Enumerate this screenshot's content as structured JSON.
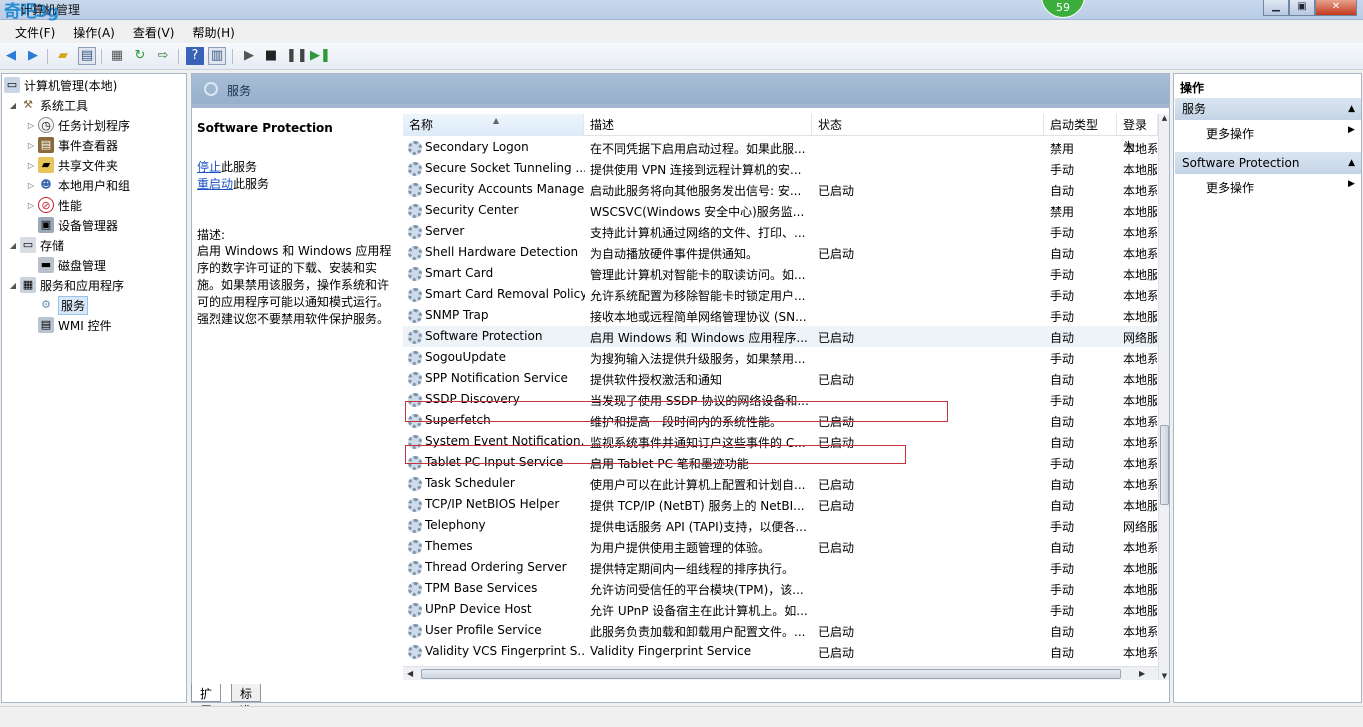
{
  "window": {
    "title": "计算机管理",
    "badge": "59",
    "logo_a": "奇吧",
    "logo_b": "3g"
  },
  "menu": [
    "文件(F)",
    "操作(A)",
    "查看(V)",
    "帮助(H)"
  ],
  "tree": [
    {
      "label": "计算机管理(本地)",
      "expander": "",
      "level": 0
    },
    {
      "label": "系统工具",
      "expander": "◢",
      "level": 1
    },
    {
      "label": "任务计划程序",
      "expander": "▷",
      "level": 2
    },
    {
      "label": "事件查看器",
      "expander": "▷",
      "level": 2
    },
    {
      "label": "共享文件夹",
      "expander": "▷",
      "level": 2
    },
    {
      "label": "本地用户和组",
      "expander": "▷",
      "level": 2
    },
    {
      "label": "性能",
      "expander": "▷",
      "level": 2
    },
    {
      "label": "设备管理器",
      "expander": "",
      "level": 2
    },
    {
      "label": "存储",
      "expander": "◢",
      "level": 1
    },
    {
      "label": "磁盘管理",
      "expander": "",
      "level": 2
    },
    {
      "label": "服务和应用程序",
      "expander": "◢",
      "level": 1
    },
    {
      "label": "服务",
      "expander": "",
      "level": 2
    },
    {
      "label": "WMI 控件",
      "expander": "",
      "level": 2
    }
  ],
  "center": {
    "header": "服务",
    "selected_service": "Software Protection",
    "stop_link": "停止",
    "stop_rest": "此服务",
    "restart_link": "重启动",
    "restart_rest": "此服务",
    "desc_label": "描述:",
    "desc_body": "启用 Windows 和 Windows 应用程序的数字许可证的下载、安装和实施。如果禁用该服务，操作系统和许可的应用程序可能以通知模式运行。强烈建议您不要禁用软件保护服务。"
  },
  "columns": [
    "名称",
    "描述",
    "状态",
    "启动类型",
    "登录为"
  ],
  "services": [
    {
      "name": "Secondary Logon",
      "desc": "在不同凭据下启用启动过程。如果此服...",
      "status": "",
      "startup": "禁用",
      "logon": "本地系统"
    },
    {
      "name": "Secure Socket Tunneling ...",
      "desc": "提供使用 VPN 连接到远程计算机的安...",
      "status": "",
      "startup": "手动",
      "logon": "本地服务"
    },
    {
      "name": "Security Accounts Manager",
      "desc": "启动此服务将向其他服务发出信号: 安...",
      "status": "已启动",
      "startup": "自动",
      "logon": "本地系统"
    },
    {
      "name": "Security Center",
      "desc": "WSCSVC(Windows 安全中心)服务监...",
      "status": "",
      "startup": "禁用",
      "logon": "本地服务"
    },
    {
      "name": "Server",
      "desc": "支持此计算机通过网络的文件、打印、...",
      "status": "",
      "startup": "手动",
      "logon": "本地系统"
    },
    {
      "name": "Shell Hardware Detection",
      "desc": "为自动播放硬件事件提供通知。",
      "status": "已启动",
      "startup": "自动",
      "logon": "本地系统"
    },
    {
      "name": "Smart Card",
      "desc": "管理此计算机对智能卡的取读访问。如...",
      "status": "",
      "startup": "手动",
      "logon": "本地服务"
    },
    {
      "name": "Smart Card Removal Policy",
      "desc": "允许系统配置为移除智能卡时锁定用户...",
      "status": "",
      "startup": "手动",
      "logon": "本地系统"
    },
    {
      "name": "SNMP Trap",
      "desc": "接收本地或远程简单网络管理协议 (SN...",
      "status": "",
      "startup": "手动",
      "logon": "本地服务"
    },
    {
      "name": "Software Protection",
      "desc": "启用 Windows 和 Windows 应用程序...",
      "status": "已启动",
      "startup": "自动",
      "logon": "网络服务"
    },
    {
      "name": "SogouUpdate",
      "desc": "为搜狗输入法提供升级服务，如果禁用...",
      "status": "",
      "startup": "手动",
      "logon": "本地系统"
    },
    {
      "name": "SPP Notification Service",
      "desc": "提供软件授权激活和通知",
      "status": "已启动",
      "startup": "自动",
      "logon": "本地服务"
    },
    {
      "name": "SSDP Discovery",
      "desc": "当发现了使用 SSDP 协议的网络设备和...",
      "status": "",
      "startup": "手动",
      "logon": "本地服务"
    },
    {
      "name": "Superfetch",
      "desc": "维护和提高一段时间内的系统性能。",
      "status": "已启动",
      "startup": "自动",
      "logon": "本地系统"
    },
    {
      "name": "System Event Notification...",
      "desc": "监视系统事件并通知订户这些事件的 C...",
      "status": "已启动",
      "startup": "自动",
      "logon": "本地系统"
    },
    {
      "name": "Tablet PC Input Service",
      "desc": "启用 Tablet PC 笔和墨迹功能",
      "status": "",
      "startup": "手动",
      "logon": "本地系统"
    },
    {
      "name": "Task Scheduler",
      "desc": "使用户可以在此计算机上配置和计划自...",
      "status": "已启动",
      "startup": "自动",
      "logon": "本地系统"
    },
    {
      "name": "TCP/IP NetBIOS Helper",
      "desc": "提供 TCP/IP (NetBT) 服务上的 NetBI...",
      "status": "已启动",
      "startup": "自动",
      "logon": "本地服务"
    },
    {
      "name": "Telephony",
      "desc": "提供电话服务 API (TAPI)支持，以便各...",
      "status": "",
      "startup": "手动",
      "logon": "网络服务"
    },
    {
      "name": "Themes",
      "desc": "为用户提供使用主题管理的体验。",
      "status": "已启动",
      "startup": "自动",
      "logon": "本地系统"
    },
    {
      "name": "Thread Ordering Server",
      "desc": "提供特定期间内一组线程的排序执行。",
      "status": "",
      "startup": "手动",
      "logon": "本地服务"
    },
    {
      "name": "TPM Base Services",
      "desc": "允许访问受信任的平台模块(TPM)，该...",
      "status": "",
      "startup": "手动",
      "logon": "本地服务"
    },
    {
      "name": "UPnP Device Host",
      "desc": "允许 UPnP 设备宿主在此计算机上。如...",
      "status": "",
      "startup": "手动",
      "logon": "本地服务"
    },
    {
      "name": "User Profile Service",
      "desc": "此服务负责加载和卸载用户配置文件。...",
      "status": "已启动",
      "startup": "自动",
      "logon": "本地系统"
    },
    {
      "name": "Validity VCS Fingerprint S...",
      "desc": "Validity Fingerprint Service",
      "status": "已启动",
      "startup": "自动",
      "logon": "本地系统"
    }
  ],
  "tabs": [
    "扩展",
    "标准"
  ],
  "actions": {
    "title": "操作",
    "group1": "服务",
    "group1_item": "更多操作",
    "group2": "Software Protection",
    "group2_item": "更多操作"
  }
}
